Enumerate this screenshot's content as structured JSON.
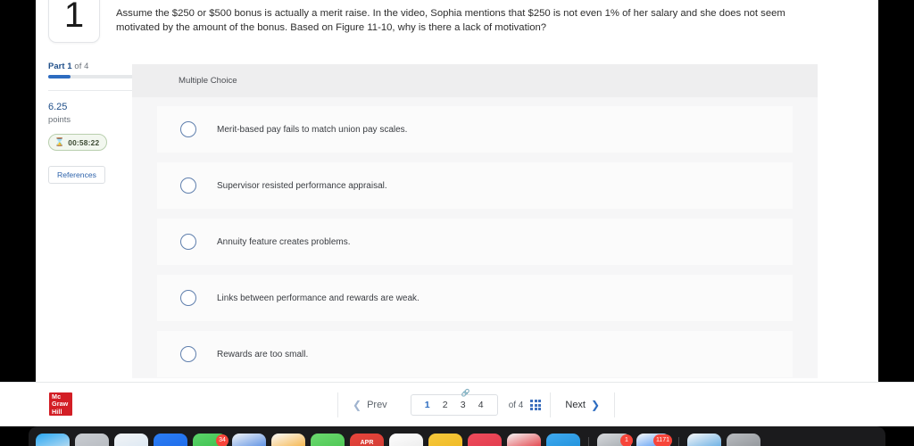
{
  "question": {
    "number": "1",
    "text": "Assume the $250 or $500 bonus is actually a merit raise. In the video, Sophia mentions that $250 is not even 1% of her salary and she does not seem motivated by the amount of the bonus. Based on Figure 11-10, why is there a lack of motivation?"
  },
  "rail": {
    "part_prefix": "Part ",
    "part_current": "1",
    "part_suffix": " of 4",
    "points_value": "6.25",
    "points_label": "points",
    "timer_icon": "hourglass-icon",
    "timer_value": "00:58:22",
    "references_label": "References"
  },
  "card": {
    "type_label": "Multiple Choice",
    "choices": [
      {
        "label": "Merit-based pay fails to match union pay scales.",
        "selected": false
      },
      {
        "label": "Supervisor resisted performance appraisal.",
        "selected": false
      },
      {
        "label": "Annuity feature creates problems.",
        "selected": false
      },
      {
        "label": "Links between performance and rewards are weak.",
        "selected": false
      },
      {
        "label": "Rewards are too small.",
        "selected": false
      }
    ]
  },
  "footer": {
    "logo_line1": "Mc",
    "logo_line2": "Graw",
    "logo_line3": "Hill",
    "prev_label": "Prev",
    "next_label": "Next",
    "prev_icon": "chevron-left-icon",
    "next_icon": "chevron-right-icon",
    "link_icon": "chain-link-icon",
    "grid_icon": "grid-view-icon",
    "pages": [
      "1",
      "2",
      "3",
      "4"
    ],
    "active_page": "1",
    "of_label": "of 4"
  },
  "dock": {
    "items": [
      {
        "name": "finder",
        "c1": "#28a8f5",
        "c2": "#d8e6ef",
        "badge": ""
      },
      {
        "name": "launchpad",
        "c1": "#c9ccd1",
        "c2": "#b5b9bf",
        "badge": ""
      },
      {
        "name": "safari",
        "c1": "#f2f4f6",
        "c2": "#d9e6f2",
        "badge": ""
      },
      {
        "name": "mail",
        "c1": "#2b7df5",
        "c2": "#1d6ae8",
        "badge": ""
      },
      {
        "name": "messages",
        "c1": "#5cd36a",
        "c2": "#36be49",
        "badge": "34"
      },
      {
        "name": "drive",
        "c1": "#f2f4f6",
        "c2": "#3a7ae0",
        "badge": ""
      },
      {
        "name": "photos",
        "c1": "#fafafa",
        "c2": "#f5a623",
        "badge": ""
      },
      {
        "name": "notes-green",
        "c1": "#6cd96f",
        "c2": "#48c44f",
        "badge": ""
      },
      {
        "name": "apr-app",
        "c1": "#e8453c",
        "c2": "#cf3a32",
        "badge": "",
        "text": "APR"
      },
      {
        "name": "podcasts-list",
        "c1": "#fdfdfd",
        "c2": "#eaeaea",
        "badge": ""
      },
      {
        "name": "notes-yellow",
        "c1": "#f6c83c",
        "c2": "#efb821",
        "badge": ""
      },
      {
        "name": "news",
        "c1": "#ef4b5c",
        "c2": "#e03a4b",
        "badge": ""
      },
      {
        "name": "netflix",
        "c1": "#f5f5f5",
        "c2": "#e01b24",
        "badge": ""
      },
      {
        "name": "twitter",
        "c1": "#3fa9f0",
        "c2": "#1e8fd8",
        "badge": ""
      },
      {
        "name": "settings",
        "c1": "#d7d9dc",
        "c2": "#9aa0a6",
        "badge": "1"
      },
      {
        "name": "facebook",
        "c1": "#fafafa",
        "c2": "#1877f2",
        "badge": "1171"
      },
      {
        "name": "downloads",
        "c1": "#f8f8f8",
        "c2": "#4a9fe0",
        "badge": ""
      },
      {
        "name": "trash",
        "c1": "#b9bcc0",
        "c2": "#8c9095",
        "badge": ""
      }
    ]
  }
}
